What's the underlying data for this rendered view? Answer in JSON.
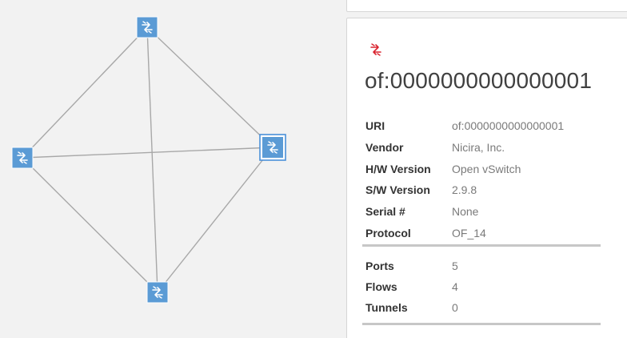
{
  "device": {
    "title": "of:0000000000000001",
    "icon": "switch-icon",
    "accent_color": "#d9232e",
    "properties": [
      {
        "key": "URI",
        "value": "of:0000000000000001"
      },
      {
        "key": "Vendor",
        "value": "Nicira, Inc."
      },
      {
        "key": "H/W Version",
        "value": "Open vSwitch"
      },
      {
        "key": "S/W Version",
        "value": "2.9.8"
      },
      {
        "key": "Serial #",
        "value": "None"
      },
      {
        "key": "Protocol",
        "value": "OF_14"
      }
    ],
    "stats": [
      {
        "key": "Ports",
        "value": "5"
      },
      {
        "key": "Flows",
        "value": "4"
      },
      {
        "key": "Tunnels",
        "value": "0"
      }
    ]
  },
  "topology": {
    "node_color": "#5b9bd5",
    "link_color": "#a8a8a8",
    "selected_node": "switch-node-east"
  }
}
